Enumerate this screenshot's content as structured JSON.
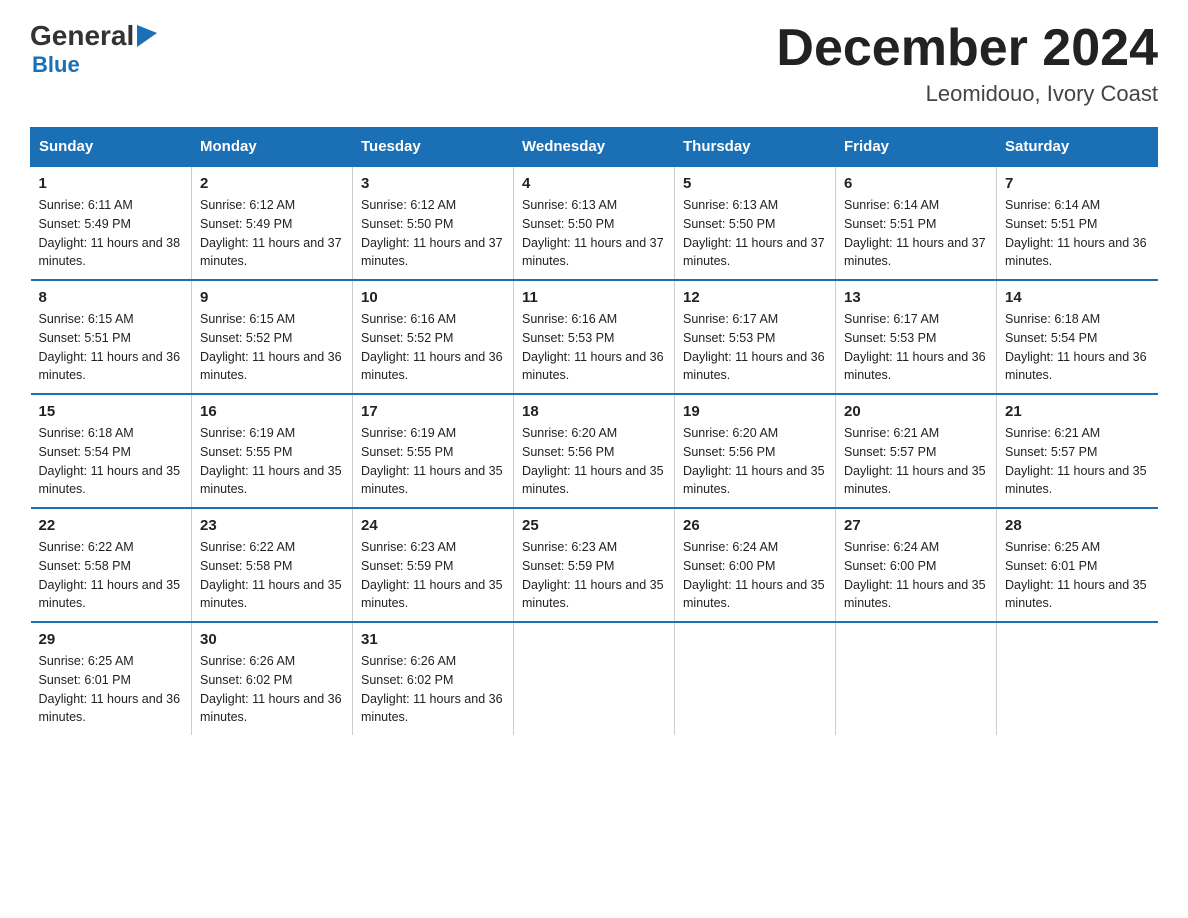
{
  "logo": {
    "part1": "General",
    "part2": "Blue"
  },
  "title": "December 2024",
  "subtitle": "Leomidouo, Ivory Coast",
  "days_header": [
    "Sunday",
    "Monday",
    "Tuesday",
    "Wednesday",
    "Thursday",
    "Friday",
    "Saturday"
  ],
  "weeks": [
    [
      {
        "day": "1",
        "sunrise": "6:11 AM",
        "sunset": "5:49 PM",
        "daylight": "11 hours and 38 minutes."
      },
      {
        "day": "2",
        "sunrise": "6:12 AM",
        "sunset": "5:49 PM",
        "daylight": "11 hours and 37 minutes."
      },
      {
        "day": "3",
        "sunrise": "6:12 AM",
        "sunset": "5:50 PM",
        "daylight": "11 hours and 37 minutes."
      },
      {
        "day": "4",
        "sunrise": "6:13 AM",
        "sunset": "5:50 PM",
        "daylight": "11 hours and 37 minutes."
      },
      {
        "day": "5",
        "sunrise": "6:13 AM",
        "sunset": "5:50 PM",
        "daylight": "11 hours and 37 minutes."
      },
      {
        "day": "6",
        "sunrise": "6:14 AM",
        "sunset": "5:51 PM",
        "daylight": "11 hours and 37 minutes."
      },
      {
        "day": "7",
        "sunrise": "6:14 AM",
        "sunset": "5:51 PM",
        "daylight": "11 hours and 36 minutes."
      }
    ],
    [
      {
        "day": "8",
        "sunrise": "6:15 AM",
        "sunset": "5:51 PM",
        "daylight": "11 hours and 36 minutes."
      },
      {
        "day": "9",
        "sunrise": "6:15 AM",
        "sunset": "5:52 PM",
        "daylight": "11 hours and 36 minutes."
      },
      {
        "day": "10",
        "sunrise": "6:16 AM",
        "sunset": "5:52 PM",
        "daylight": "11 hours and 36 minutes."
      },
      {
        "day": "11",
        "sunrise": "6:16 AM",
        "sunset": "5:53 PM",
        "daylight": "11 hours and 36 minutes."
      },
      {
        "day": "12",
        "sunrise": "6:17 AM",
        "sunset": "5:53 PM",
        "daylight": "11 hours and 36 minutes."
      },
      {
        "day": "13",
        "sunrise": "6:17 AM",
        "sunset": "5:53 PM",
        "daylight": "11 hours and 36 minutes."
      },
      {
        "day": "14",
        "sunrise": "6:18 AM",
        "sunset": "5:54 PM",
        "daylight": "11 hours and 36 minutes."
      }
    ],
    [
      {
        "day": "15",
        "sunrise": "6:18 AM",
        "sunset": "5:54 PM",
        "daylight": "11 hours and 35 minutes."
      },
      {
        "day": "16",
        "sunrise": "6:19 AM",
        "sunset": "5:55 PM",
        "daylight": "11 hours and 35 minutes."
      },
      {
        "day": "17",
        "sunrise": "6:19 AM",
        "sunset": "5:55 PM",
        "daylight": "11 hours and 35 minutes."
      },
      {
        "day": "18",
        "sunrise": "6:20 AM",
        "sunset": "5:56 PM",
        "daylight": "11 hours and 35 minutes."
      },
      {
        "day": "19",
        "sunrise": "6:20 AM",
        "sunset": "5:56 PM",
        "daylight": "11 hours and 35 minutes."
      },
      {
        "day": "20",
        "sunrise": "6:21 AM",
        "sunset": "5:57 PM",
        "daylight": "11 hours and 35 minutes."
      },
      {
        "day": "21",
        "sunrise": "6:21 AM",
        "sunset": "5:57 PM",
        "daylight": "11 hours and 35 minutes."
      }
    ],
    [
      {
        "day": "22",
        "sunrise": "6:22 AM",
        "sunset": "5:58 PM",
        "daylight": "11 hours and 35 minutes."
      },
      {
        "day": "23",
        "sunrise": "6:22 AM",
        "sunset": "5:58 PM",
        "daylight": "11 hours and 35 minutes."
      },
      {
        "day": "24",
        "sunrise": "6:23 AM",
        "sunset": "5:59 PM",
        "daylight": "11 hours and 35 minutes."
      },
      {
        "day": "25",
        "sunrise": "6:23 AM",
        "sunset": "5:59 PM",
        "daylight": "11 hours and 35 minutes."
      },
      {
        "day": "26",
        "sunrise": "6:24 AM",
        "sunset": "6:00 PM",
        "daylight": "11 hours and 35 minutes."
      },
      {
        "day": "27",
        "sunrise": "6:24 AM",
        "sunset": "6:00 PM",
        "daylight": "11 hours and 35 minutes."
      },
      {
        "day": "28",
        "sunrise": "6:25 AM",
        "sunset": "6:01 PM",
        "daylight": "11 hours and 35 minutes."
      }
    ],
    [
      {
        "day": "29",
        "sunrise": "6:25 AM",
        "sunset": "6:01 PM",
        "daylight": "11 hours and 36 minutes."
      },
      {
        "day": "30",
        "sunrise": "6:26 AM",
        "sunset": "6:02 PM",
        "daylight": "11 hours and 36 minutes."
      },
      {
        "day": "31",
        "sunrise": "6:26 AM",
        "sunset": "6:02 PM",
        "daylight": "11 hours and 36 minutes."
      },
      null,
      null,
      null,
      null
    ]
  ],
  "labels": {
    "sunrise": "Sunrise:",
    "sunset": "Sunset:",
    "daylight": "Daylight:"
  }
}
